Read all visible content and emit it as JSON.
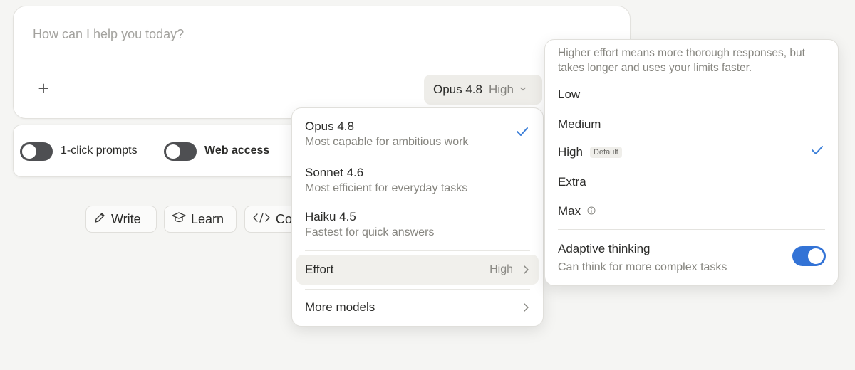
{
  "composer": {
    "placeholder": "How can I help you today?",
    "plus_label": "+",
    "model_button": {
      "model": "Opus 4.8",
      "effort": "High"
    }
  },
  "toggles": {
    "one_click": {
      "label": "1-click prompts",
      "on": false
    },
    "web_access": {
      "label": "Web access",
      "on": false
    }
  },
  "chips": [
    {
      "label": "Write",
      "icon": "pencil-icon"
    },
    {
      "label": "Learn",
      "icon": "graduation-cap-icon"
    },
    {
      "label": "Code",
      "icon": "code-icon"
    }
  ],
  "model_menu": {
    "models": [
      {
        "name": "Opus 4.8",
        "desc": "Most capable for ambitious work",
        "selected": true
      },
      {
        "name": "Sonnet 4.6",
        "desc": "Most efficient for everyday tasks",
        "selected": false
      },
      {
        "name": "Haiku 4.5",
        "desc": "Fastest for quick answers",
        "selected": false
      }
    ],
    "effort": {
      "label": "Effort",
      "value": "High"
    },
    "more_models": "More models"
  },
  "effort_panel": {
    "description": "Higher effort means more thorough responses, but takes longer and uses your limits faster.",
    "levels": [
      {
        "label": "Low"
      },
      {
        "label": "Medium"
      },
      {
        "label": "High",
        "badge": "Default",
        "selected": true
      },
      {
        "label": "Extra"
      },
      {
        "label": "Max",
        "info": true
      }
    ],
    "adaptive": {
      "title": "Adaptive thinking",
      "subtitle": "Can think for more complex tasks",
      "on": true
    }
  },
  "colors": {
    "accent": "#3373d6",
    "check": "#3c7fd8",
    "toggle_off": "#4e4f52"
  }
}
